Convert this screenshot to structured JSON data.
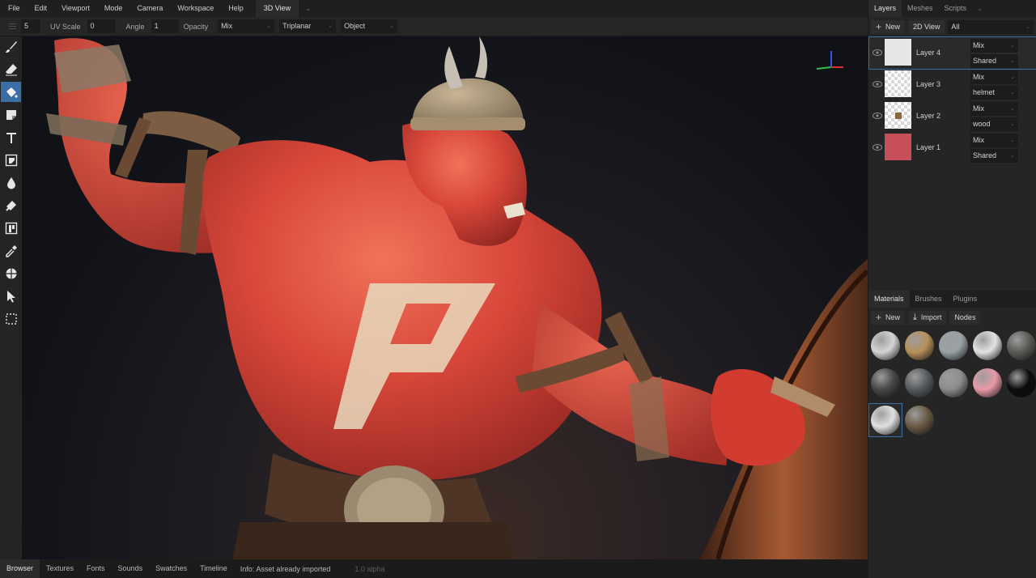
{
  "menu": {
    "items": [
      "File",
      "Edit",
      "Viewport",
      "Mode",
      "Camera",
      "Workspace",
      "Help"
    ],
    "view_tab": "3D View"
  },
  "options": {
    "brush_radius": "5",
    "uv_scale_label": "UV Scale",
    "uv_scale_value": "0",
    "angle_label": "Angle",
    "angle_value": "1",
    "opacity_label": "Opacity",
    "blend_mode": "Mix",
    "projection": "Triplanar",
    "fill_mode": "Object"
  },
  "toolbar": {
    "tools": [
      "brush-icon",
      "eraser-icon",
      "fill-bucket-icon",
      "decal-icon",
      "text-icon",
      "clone-icon",
      "blur-icon",
      "smudge-icon",
      "bake-icon",
      "picker-icon",
      "material-picker-icon",
      "select-icon",
      "marquee-icon"
    ],
    "active_tool": "fill-bucket-icon",
    "accent": "#3a6ea5"
  },
  "viewport": {
    "decal_glyph": "P",
    "skin_color": "#d9473a",
    "background": "#101218"
  },
  "statusbar": {
    "tabs": [
      "Browser",
      "Textures",
      "Fonts",
      "Sounds",
      "Swatches",
      "Timeline"
    ],
    "active_tab": "Browser",
    "info": "Info: Asset already imported",
    "version": "1.0 alpha"
  },
  "layers_panel": {
    "tabs": [
      "Layers",
      "Meshes",
      "Scripts"
    ],
    "active_tab": "Layers",
    "new_label": "New",
    "view2d_label": "2D View",
    "filter": "All",
    "layers": [
      {
        "name": "Layer 4",
        "blend": "Mix",
        "object": "Shared",
        "selected": true,
        "thumb": "white"
      },
      {
        "name": "Layer 3",
        "blend": "Mix",
        "object": "helmet",
        "selected": false,
        "thumb": "checker"
      },
      {
        "name": "Layer 2",
        "blend": "Mix",
        "object": "wood",
        "selected": false,
        "thumb": "decal"
      },
      {
        "name": "Layer 1",
        "blend": "Mix",
        "object": "Shared",
        "selected": false,
        "thumb": "red"
      }
    ]
  },
  "materials_panel": {
    "tabs": [
      "Materials",
      "Brushes",
      "Plugins"
    ],
    "active_tab": "Materials",
    "new_label": "New",
    "import_label": "Import",
    "nodes_label": "Nodes",
    "materials": [
      {
        "color": "#d4d4d4"
      },
      {
        "color": "#b8905a"
      },
      {
        "color": "#9aa2a6"
      },
      {
        "color": "#e2e2e2"
      },
      {
        "color": "#5c5a55"
      },
      {
        "color": "#484848"
      },
      {
        "color": "#575b5e"
      },
      {
        "color": "#8d8b8b"
      },
      {
        "color": "#e89aa6"
      },
      {
        "color": "#0b0b0b"
      },
      {
        "color": "#e0e0e0"
      },
      {
        "color": "#6a5a46"
      }
    ],
    "selected_index": 10
  }
}
